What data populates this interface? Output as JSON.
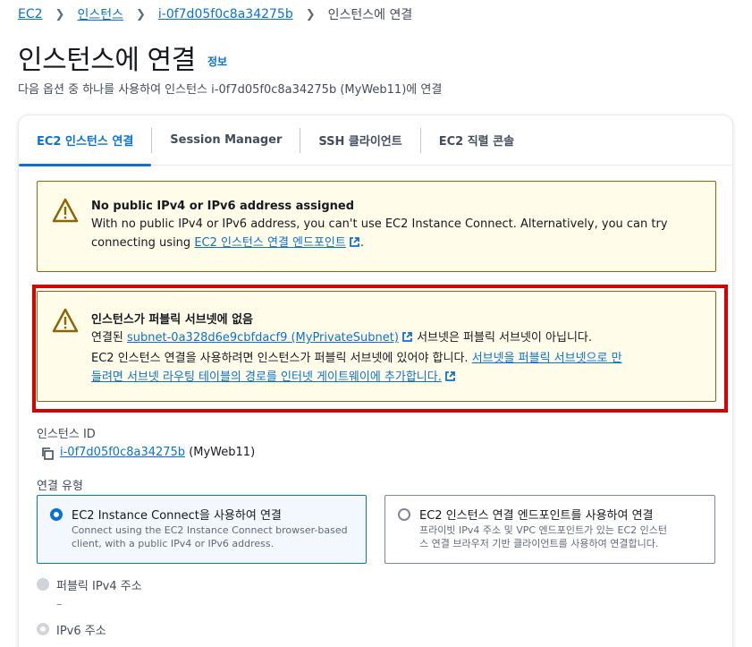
{
  "breadcrumb": {
    "items": [
      "EC2",
      "인스턴스",
      "i-0f7d05f0c8a34275b"
    ],
    "current": "인스턴스에 연결"
  },
  "page": {
    "title": "인스턴스에 연결",
    "info": "정보",
    "description": "다음 옵션 중 하나를 사용하여 인스턴스 i-0f7d05f0c8a34275b (MyWeb11)에 연결"
  },
  "tabs": [
    "EC2 인스턴스 연결",
    "Session Manager",
    "SSH 클라이언트",
    "EC2 직렬 콘솔"
  ],
  "alert1": {
    "title": "No public IPv4 or IPv6 address assigned",
    "line1": "With no public IPv4 or IPv6 address, you can't use EC2 Instance Connect. Alternatively, you can try",
    "line2_prefix": "connecting using ",
    "link": "EC2 인스턴스 연결 엔드포인트",
    "line2_suffix": "."
  },
  "alert2": {
    "title": "인스턴스가 퍼블릭 서브넷에 없음",
    "line1_prefix": "연결된 ",
    "subnet_link": "subnet-0a328d6e9cbfdacf9 (MyPrivateSubnet)",
    "line1_suffix": " 서브넷은 퍼블릭 서브넷이 아닙니다.",
    "line2_prefix": "EC2 인스턴스 연결을 사용하려면 인스턴스가 퍼블릭 서브넷에 있어야 합니다. ",
    "help_link_1": "서브넷을 퍼블릭 서브넷으로 만",
    "help_link_2": "들려면 서브넷 라우팅 테이블의 경로를 인터넷 게이트웨이에 추가합니다."
  },
  "instance": {
    "label": "인스턴스 ID",
    "id_link": "i-0f7d05f0c8a34275b",
    "name": "(MyWeb11)"
  },
  "connection_type": {
    "label": "연결 유형",
    "option1_title": "EC2 Instance Connect을 사용하여 연결",
    "option1_desc_1": "Connect using the EC2 Instance Connect browser-based",
    "option1_desc_2": "client, with a public IPv4 or IPv6 address.",
    "option2_title": "EC2 인스턴스 연결 엔드포인트를 사용하여 연결",
    "option2_desc_1": "프라이빗 IPv4 주소 및 VPC 엔드포인트가 있는 EC2 인스턴",
    "option2_desc_2": "스 연결 브라우저 기반 클라이언트를 사용하여 연결합니다."
  },
  "ip_options": {
    "public_ipv4_label": "퍼블릭 IPv4 주소",
    "public_ipv4_value": "–",
    "ipv6_label": "IPv6 주소"
  },
  "colors": {
    "link": "#0972d3",
    "warning_border": "#8d6605",
    "warning_bg": "#fffce9",
    "highlight_frame": "#d80000"
  }
}
